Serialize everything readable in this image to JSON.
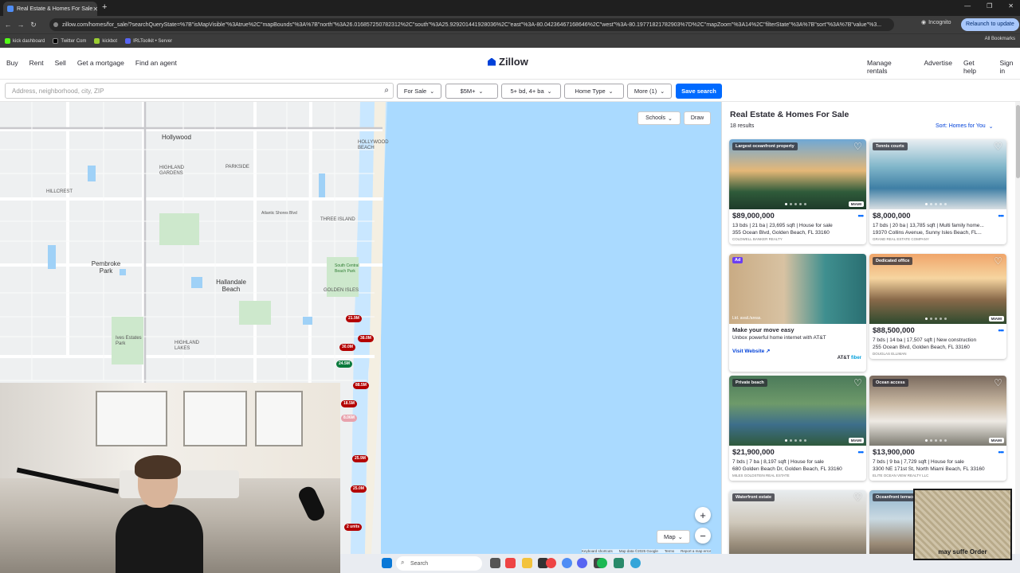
{
  "browser": {
    "tab_title": "Real Estate & Homes For Sale",
    "url": "zillow.com/homes/for_sale/?searchQueryState=%7B\"isMapVisible\"%3Atrue%2C\"mapBounds\"%3A%7B\"north\"%3A26.016857250782312%2C\"south\"%3A25.929201441928036%2C\"east\"%3A-80.04236467168646%2C\"west\"%3A-80.19771821782903%7D%2C\"mapZoom\"%3A14%2C\"filterState\"%3A%7B\"sort\"%3A%7B\"value\"%3...",
    "incognito": "Incognito",
    "relaunch": "Relaunch to update",
    "bookmarks": [
      "kick dashboard",
      "Twitter Com",
      "kickbot",
      "IRLToolkit • Server"
    ],
    "all_bookmarks": "All Bookmarks"
  },
  "header": {
    "nav_left": [
      "Buy",
      "Rent",
      "Sell",
      "Get a mortgage",
      "Find an agent"
    ],
    "logo": "Zillow",
    "nav_right": [
      "Manage rentals",
      "Advertise",
      "Get help",
      "Sign in"
    ]
  },
  "search": {
    "placeholder": "Address, neighborhood, city, ZIP",
    "filters": [
      "For Sale",
      "$5M+",
      "5+ bd, 4+ ba",
      "Home Type",
      "More (1)"
    ],
    "save": "Save search"
  },
  "map": {
    "buttons": {
      "schools": "Schools",
      "draw": "Draw",
      "map_type": "Map"
    },
    "cities": [
      "Hollywood",
      "Pembroke Park",
      "Hallandale Beach"
    ],
    "places": [
      "HOLLYWOOD BEACH",
      "HIGHLAND GARDENS",
      "PARKSIDE",
      "HILLCREST",
      "THREE ISLAND",
      "GOLDEN ISLES",
      "Ives Estates Park",
      "HIGHLAND LAKES",
      "Atlantic Shores Blvd",
      "South Central Beach Park"
    ],
    "pins": [
      "21.9M",
      "38.0M",
      "30.0M",
      "24.5M",
      "88.5M",
      "18.5M",
      "8.06M",
      "25.9M",
      "25.0M",
      "2 units"
    ],
    "attribution": [
      "Keyboard shortcuts",
      "Map data ©2025 Google",
      "Terms",
      "Report a map error"
    ]
  },
  "listings": {
    "title": "Real Estate & Homes For Sale",
    "count": "18 results",
    "sort": "Sort: Homes for You",
    "cards": [
      {
        "badge": "Largest oceanfront property",
        "price": "$89,000,000",
        "facts": "13 bds | 21 ba | 23,695 sqft | House for sale",
        "address": "355 Ocean Blvd, Golden Beach, FL 33160",
        "broker": "COLDWELL BANKER REALTY"
      },
      {
        "badge": "Tennis courts",
        "price": "$8,000,000",
        "facts": "17 bds | 20 ba | 13,785 sqft | Multi family home...",
        "address": "19370 Collins Avenue, Sunny Isles Beach, FL...",
        "broker": "GRAND REAL ESTATE COMPANY"
      },
      {
        "badge": "Dedicated office",
        "price": "$88,500,000",
        "facts": "7 bds | 14 ba | 17,507 sqft | New construction",
        "address": "255 Ocean Blvd, Golden Beach, FL 33160",
        "broker": "DOUGLAS ELLIMAN"
      },
      {
        "badge": "Private beach",
        "price": "$21,900,000",
        "facts": "7 bds | 7 ba | 8,197 sqft | House for sale",
        "address": "680 Golden Beach Dr, Golden Beach, FL 33160",
        "broker": "MILES GOLDSTEIN REAL ESTATE"
      },
      {
        "badge": "Ocean access",
        "price": "$13,900,000",
        "facts": "7 bds | 9 ba | 7,729 sqft | House for sale",
        "address": "3300 NE 171st St, North Miami Beach, FL 33160",
        "broker": "ELITE OCEAN VIEW REALTY LLC"
      },
      {
        "badge": "Waterfront estate",
        "price": "",
        "facts": "",
        "address": "",
        "broker": ""
      },
      {
        "badge": "Oceanfront terrace",
        "price": "",
        "facts": "",
        "address": "",
        "broker": ""
      }
    ],
    "ad": {
      "tag": "Ad",
      "image_text": "Ltd. avail./areas.",
      "title": "Make your move easy",
      "text": "Unbox powerful home internet with AT&T",
      "link": "Visit Website",
      "logo_a": "AT&T",
      "logo_b": "fiber"
    },
    "mark_text": "MIAMI"
  },
  "taskbar": {
    "search": "Search"
  },
  "watermark": "may suffe Order"
}
